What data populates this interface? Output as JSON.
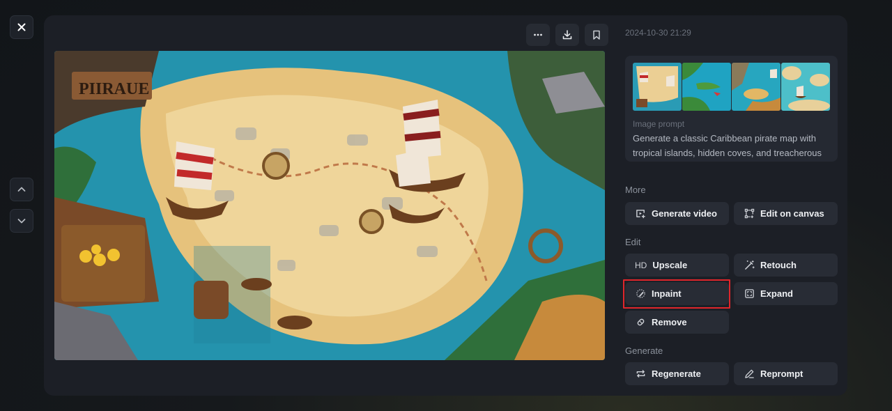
{
  "nav": {
    "close_icon": "close-icon",
    "prev_icon": "chevron-up-icon",
    "next_icon": "chevron-down-icon"
  },
  "toolbar": {
    "more_icon": "more-horizontal-icon",
    "download_icon": "download-icon",
    "bookmark_icon": "bookmark-icon"
  },
  "image": {
    "description": "Cartoon Caribbean pirate treasure map with sailing ships, islands, treasure chest and a sign",
    "sign_text": "PIIRAUE"
  },
  "details": {
    "timestamp": "2024-10-30 21:29",
    "thumbnails": [
      {
        "description": "Pirate map variation 1 - sandy island with ships"
      },
      {
        "description": "Pirate map variation 2 - blue sea with green islands"
      },
      {
        "description": "Pirate map variation 3 - turquoise sea with ships"
      },
      {
        "description": "Pirate map variation 4 - islands with ship"
      }
    ],
    "prompt_label": "Image prompt",
    "prompt_text": "Generate a classic Caribbean pirate map with tropical islands, hidden coves, and treacherous seas. In"
  },
  "sections": {
    "more": {
      "label": "More",
      "buttons": [
        {
          "label": "Generate video",
          "icon": "video-icon"
        },
        {
          "label": "Edit on canvas",
          "icon": "canvas-icon"
        }
      ]
    },
    "edit": {
      "label": "Edit",
      "buttons": [
        {
          "label": "Upscale",
          "icon_text": "HD"
        },
        {
          "label": "Retouch",
          "icon": "magic-wand-icon"
        },
        {
          "label": "Inpaint",
          "icon": "brush-icon",
          "highlighted": true
        },
        {
          "label": "Expand",
          "icon": "expand-icon"
        },
        {
          "label": "Remove",
          "icon": "eraser-icon"
        }
      ]
    },
    "generate": {
      "label": "Generate",
      "buttons": [
        {
          "label": "Regenerate",
          "icon": "repeat-icon"
        },
        {
          "label": "Reprompt",
          "icon": "pen-icon"
        }
      ]
    }
  },
  "colors": {
    "highlight": "#e0262b",
    "panel": "#1c1f26",
    "button": "#282c35"
  }
}
